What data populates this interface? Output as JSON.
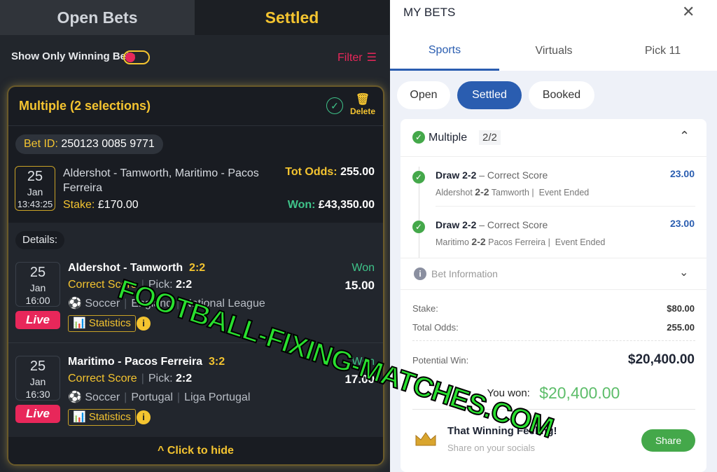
{
  "left": {
    "tabs": [
      {
        "label": "Open Bets"
      },
      {
        "label": "Settled"
      }
    ],
    "toggle_label": "Show Only Winning Bets",
    "toggle_on": false,
    "filter_label": "Filter",
    "bet": {
      "title": "Multiple (2 selections)",
      "delete_label": "Delete",
      "bet_id_label": "Bet ID:",
      "bet_id": "250123 0085 9771",
      "date_day": "25",
      "date_month": "Jan",
      "date_time": "13:43:25",
      "events": "Aldershot - Tamworth, Maritimo - Pacos Ferreira",
      "stake_label": "Stake:",
      "stake": "£170.00",
      "tot_odds_label": "Tot Odds:",
      "tot_odds": "255.00",
      "won_label": "Won:",
      "won": "£43,350.00",
      "details_label": "Details:",
      "selections": [
        {
          "day": "25",
          "month": "Jan",
          "time": "16:00",
          "live": "Live",
          "match": "Aldershot - Tamworth",
          "score": "2:2",
          "market": "Correct Score",
          "pick_label": "Pick:",
          "pick": "2:2",
          "sport": "Soccer",
          "country": "England",
          "league": "National League",
          "stats": "Statistics",
          "status": "Won",
          "odds": "15.00"
        },
        {
          "day": "25",
          "month": "Jan",
          "time": "16:30",
          "live": "Live",
          "match": "Maritimo - Pacos Ferreira",
          "score": "3:2",
          "market": "Correct Score",
          "pick_label": "Pick:",
          "pick": "2:2",
          "sport": "Soccer",
          "country": "Portugal",
          "league": "Liga Portugal",
          "stats": "Statistics",
          "status": "Won",
          "odds": "17.00"
        }
      ],
      "hide_label": "Click to hide"
    }
  },
  "right": {
    "title": "MY BETS",
    "tabs": [
      {
        "label": "Sports",
        "active": true
      },
      {
        "label": "Virtuals"
      },
      {
        "label": "Pick 11"
      }
    ],
    "filters": [
      {
        "label": "Open"
      },
      {
        "label": "Settled",
        "active": true
      },
      {
        "label": "Booked"
      }
    ],
    "bet": {
      "type": "Multiple",
      "count": "2/2",
      "legs": [
        {
          "pick": "Draw 2-2",
          "market": "– Correct Score",
          "home": "Aldershot",
          "score": "2-2",
          "away": "Tamworth |",
          "status": "Event Ended",
          "odds": "23.00"
        },
        {
          "pick": "Draw 2-2",
          "market": "– Correct Score",
          "home": "Maritimo",
          "score": "2-2",
          "away": "Pacos Ferreira |",
          "status": "Event Ended",
          "odds": "23.00"
        }
      ],
      "info_label": "Bet Information",
      "stake_label": "Stake:",
      "stake": "$80.00",
      "odds_label": "Total Odds:",
      "odds": "255.00",
      "potential_label": "Potential Win:",
      "potential": "$20,400.00",
      "you_won_label": "You won:",
      "you_won": "$20,400.00",
      "share_title": "That Winning Feeling!",
      "share_sub": "Share on your socials",
      "share_button": "Share"
    }
  },
  "watermark": "FOOTBALL-FIXING-MATCHES.COM",
  "colors": {
    "accent_yellow": "#f4c430",
    "won_green": "#3fc48a",
    "live_red": "#e8275a",
    "brand_blue": "#2a5db0",
    "success_green": "#44a84a"
  }
}
